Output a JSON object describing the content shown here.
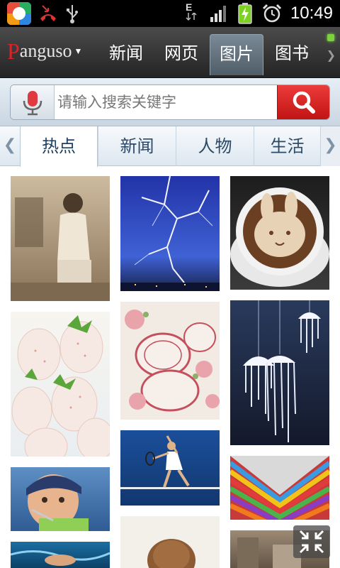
{
  "status_bar": {
    "time": "10:49",
    "network": "E",
    "icons": [
      "app-icon",
      "missed-call-icon",
      "usb-icon",
      "signal-icon",
      "battery-charging-icon",
      "alarm-icon"
    ]
  },
  "top_bar": {
    "logo": {
      "first": "P",
      "rest": "anguso"
    },
    "tabs": [
      {
        "label": "新闻",
        "active": false
      },
      {
        "label": "网页",
        "active": false
      },
      {
        "label": "图片",
        "active": true
      },
      {
        "label": "图书",
        "active": false
      }
    ]
  },
  "search": {
    "placeholder": "请输入搜索关键字",
    "value": ""
  },
  "categories": {
    "items": [
      {
        "label": "热点",
        "active": true
      },
      {
        "label": "新闻",
        "active": false
      },
      {
        "label": "人物",
        "active": false
      },
      {
        "label": "生活",
        "active": false
      }
    ]
  },
  "photos": [
    {
      "name": "photo-sepia-portrait"
    },
    {
      "name": "photo-lightning"
    },
    {
      "name": "photo-latte-art"
    },
    {
      "name": "photo-white-strawberries"
    },
    {
      "name": "photo-floral-plates"
    },
    {
      "name": "photo-jellyfish-lamps"
    },
    {
      "name": "photo-child-eating"
    },
    {
      "name": "photo-tennis-player"
    },
    {
      "name": "photo-rainbow-stripes"
    },
    {
      "name": "photo-swimmer"
    },
    {
      "name": "photo-brown-food"
    },
    {
      "name": "photo-street-scene"
    }
  ],
  "colors": {
    "accent_red": "#d8232a",
    "search_button": "#c21414",
    "active_tab": "#5f6f7b",
    "category_text": "#2c4a67"
  }
}
